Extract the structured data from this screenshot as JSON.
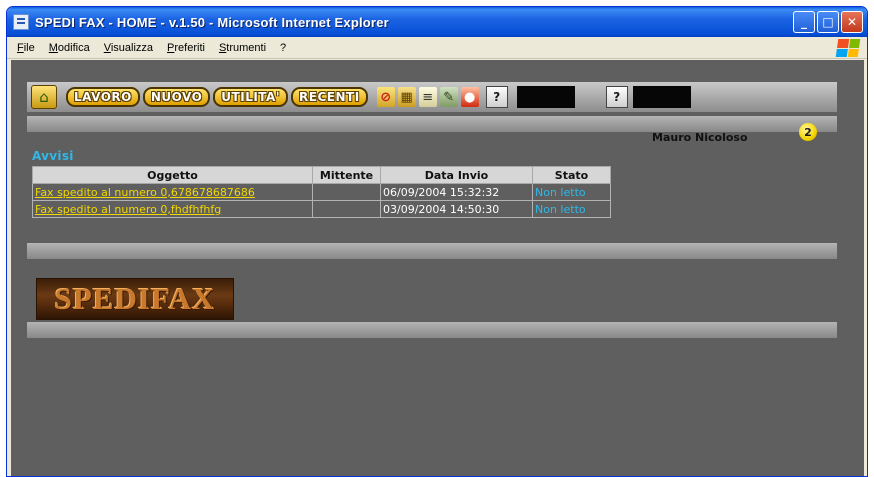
{
  "window": {
    "title": "SPEDI FAX - HOME - v.1.50 - Microsoft Internet Explorer",
    "minimize": "_",
    "maximize": "□",
    "close": "✕"
  },
  "menu": {
    "items": [
      "File",
      "Modifica",
      "Visualizza",
      "Preferiti",
      "Strumenti",
      "?"
    ]
  },
  "toolbar": {
    "home_icon": "home-icon",
    "buttons": [
      "LAVORO",
      "NUOVO",
      "UTILITA'",
      "RECENTI"
    ],
    "help_1": "?",
    "help_2": "?"
  },
  "user": {
    "name": "Mauro Nicoloso",
    "badge": "2"
  },
  "avvisi": {
    "title": "Avvisi",
    "columns": [
      "Oggetto",
      "Mittente",
      "Data Invio",
      "Stato"
    ],
    "rows": [
      {
        "oggetto": "Fax spedito al numero 0,678678687686",
        "mittente": "",
        "data": "06/09/2004 15:32:32",
        "stato": "Non letto"
      },
      {
        "oggetto": "Fax spedito al numero 0,fhdfhfhfg",
        "mittente": "",
        "data": "03/09/2004 14:50:30",
        "stato": "Non letto"
      }
    ]
  },
  "logo": {
    "text": "SPEDIFAX"
  },
  "colors": {
    "page_bg": "#5f5f5f",
    "link": "#f2d700",
    "status": "#2fb8e8"
  }
}
